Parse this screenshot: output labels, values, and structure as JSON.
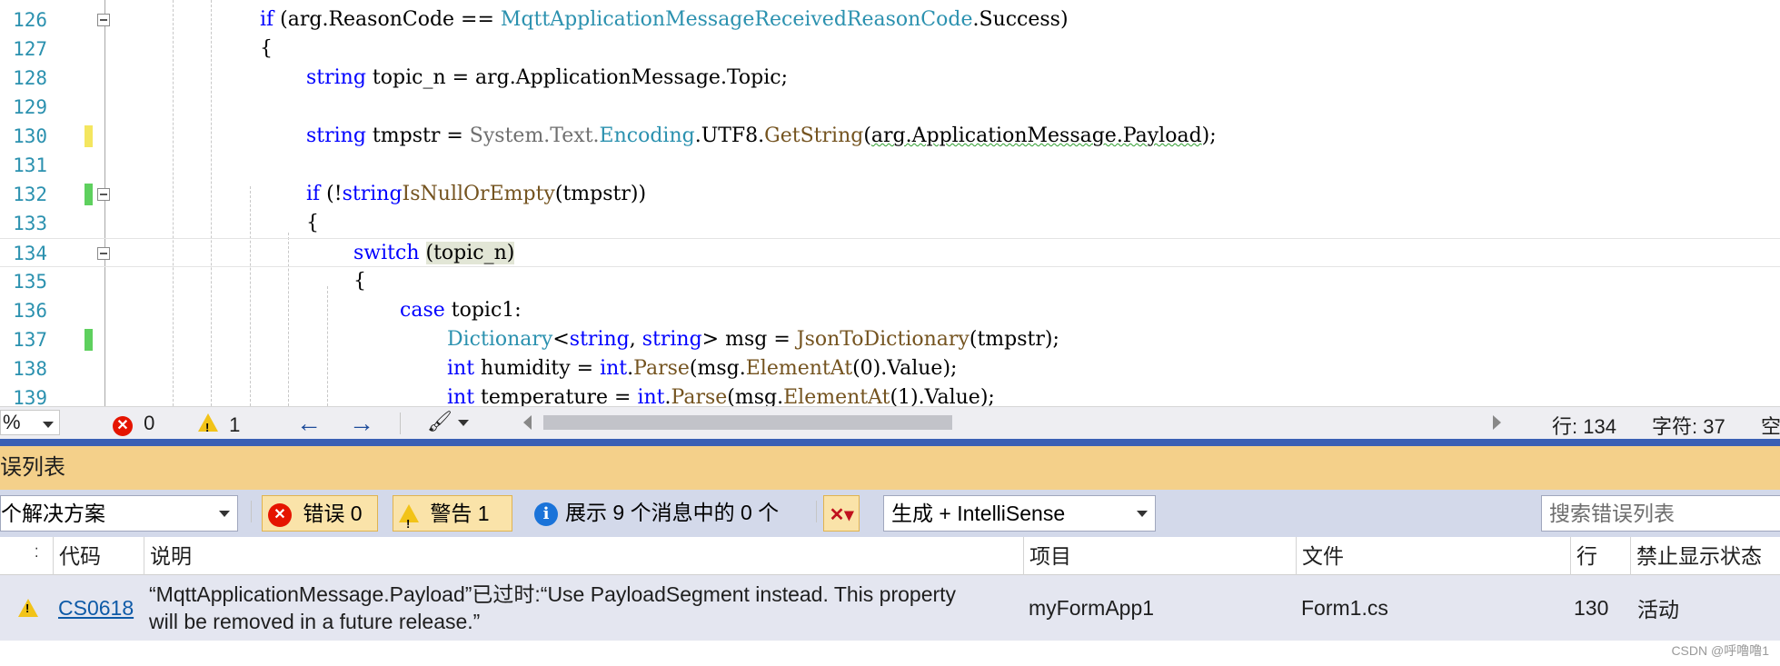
{
  "editor": {
    "lines": [
      {
        "num": "126"
      },
      {
        "num": "127"
      },
      {
        "num": "128"
      },
      {
        "num": "129"
      },
      {
        "num": "130"
      },
      {
        "num": "131"
      },
      {
        "num": "132"
      },
      {
        "num": "133"
      },
      {
        "num": "134"
      },
      {
        "num": "135"
      },
      {
        "num": "136"
      },
      {
        "num": "137"
      },
      {
        "num": "138"
      },
      {
        "num": "139"
      }
    ],
    "code": {
      "l126": {
        "kw": "if",
        "a": " (arg.ReasonCode == ",
        "type": "MqttApplicationMessageReceivedReasonCode",
        "b": ".Success)"
      },
      "l127": {
        "a": "{"
      },
      "l128": {
        "kw": "string",
        "a": " topic_n = arg.ApplicationMessage.Topic;"
      },
      "l130": {
        "kw": "string",
        "a": " tmpstr = ",
        "sys": "System.Text.",
        "type": "Encoding",
        "b": ".UTF8.",
        "method": "GetString",
        "c": "(",
        "squig": "arg.ApplicationMessage.Payload",
        "d": ");"
      },
      "l132": {
        "kw": "if",
        "a": " (!",
        "kw2": "string",
        ".": ".",
        "method": "IsNullOrEmpty",
        "b": "(tmpstr))"
      },
      "l133": {
        "a": "{"
      },
      "l134": {
        "kw": "switch",
        "a": " ",
        "hl": "(topic_n)"
      },
      "l135": {
        "a": "{"
      },
      "l136": {
        "kw": "case",
        "a": " topic1:"
      },
      "l137": {
        "type": "Dictionary",
        "a": "<",
        "kw1": "string",
        "b": ", ",
        "kw2": "string",
        "c": "> msg = ",
        "method": "JsonToDictionary",
        "d": "(tmpstr);"
      },
      "l138": {
        "kw": "int",
        "a": " humidity = ",
        "kw2": "int",
        "b": ".",
        "method": "Parse",
        "c": "(msg.",
        "method2": "ElementAt",
        "d": "(0).Value);"
      },
      "l139": {
        "kw": "int",
        "a": " temperature = ",
        "kw2": "int",
        "b": ".",
        "method": "Parse",
        "c": "(msg.",
        "method2": "ElementAt",
        "d": "(1).Value);"
      }
    }
  },
  "status": {
    "zoom": "%",
    "errors": "0",
    "warnings": "1",
    "line": "行: 134",
    "char": "字符: 37",
    "mode": "空"
  },
  "error_list": {
    "title": "误列表",
    "scope": "个解决方案",
    "errors_toggle": "错误 0",
    "warnings_toggle": "警告 1",
    "messages_toggle": "展示 9 个消息中的 0 个",
    "build_filter": "生成 + IntelliSense",
    "search_placeholder": "搜索错误列表",
    "columns": {
      "code": "代码",
      "desc": "说明",
      "project": "项目",
      "file": "文件",
      "line": "行",
      "suppress": "禁止显示状态"
    },
    "rows": [
      {
        "code": "CS0618",
        "desc": "“MqttApplicationMessage.Payload”已过时:“Use PayloadSegment instead. This property will be removed in a future release.”",
        "project": "myFormApp1",
        "file": "Form1.cs",
        "line": "130",
        "suppress": "活动"
      }
    ]
  },
  "watermark": "CSDN @呼噜噜1"
}
